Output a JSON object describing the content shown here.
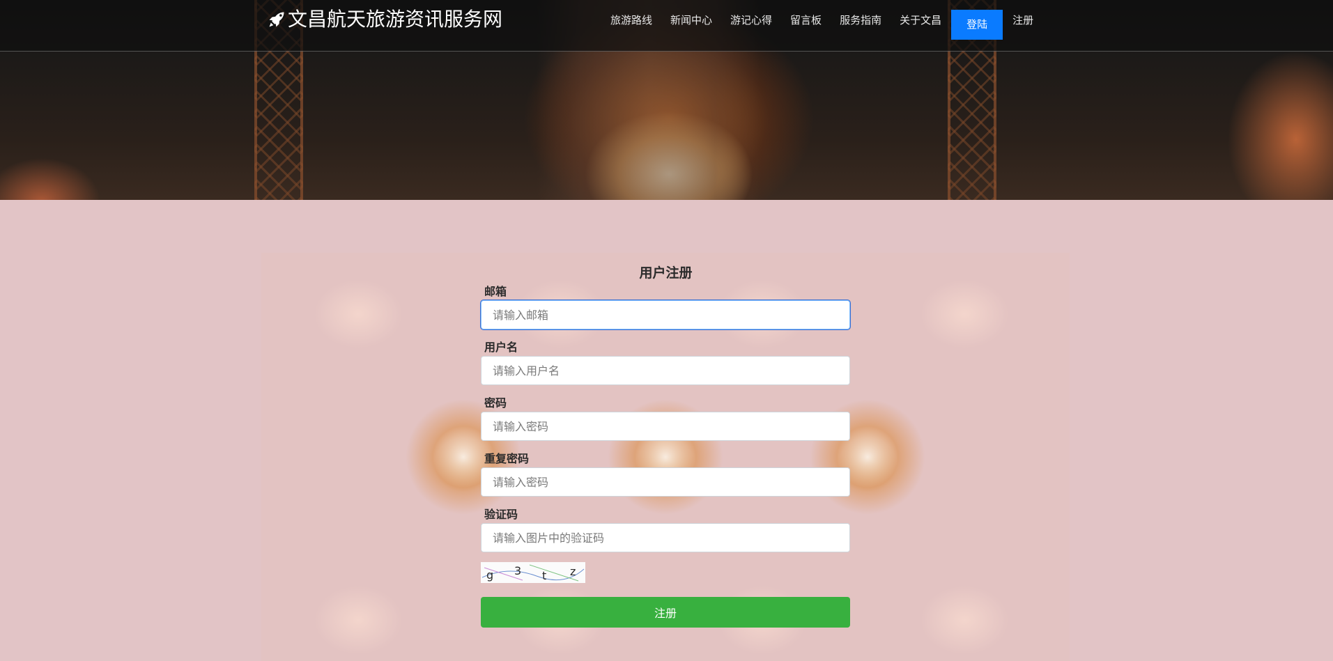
{
  "header": {
    "brand_icon": "rocket-icon",
    "brand_title": "文昌航天旅游资讯服务网",
    "nav_items": [
      "旅游路线",
      "新闻中心",
      "游记心得",
      "留言板",
      "服务指南",
      "关于文昌"
    ],
    "login_label": "登陆",
    "register_label": "注册"
  },
  "form": {
    "title": "用户注册",
    "email": {
      "label": "邮箱",
      "placeholder": "请输入邮箱",
      "value": ""
    },
    "username": {
      "label": "用户名",
      "placeholder": "请输入用户名",
      "value": ""
    },
    "password": {
      "label": "密码",
      "placeholder": "请输入密码",
      "value": ""
    },
    "repeat_password": {
      "label": "重复密码",
      "placeholder": "请输入密码",
      "value": ""
    },
    "captcha": {
      "label": "验证码",
      "placeholder": "请输入图片中的验证码",
      "value": "",
      "image_text": "g3tz"
    },
    "submit_label": "注册"
  },
  "colors": {
    "accent": "#0a7bff",
    "submit": "#38b03f",
    "page_bg": "#e2c4c6"
  }
}
